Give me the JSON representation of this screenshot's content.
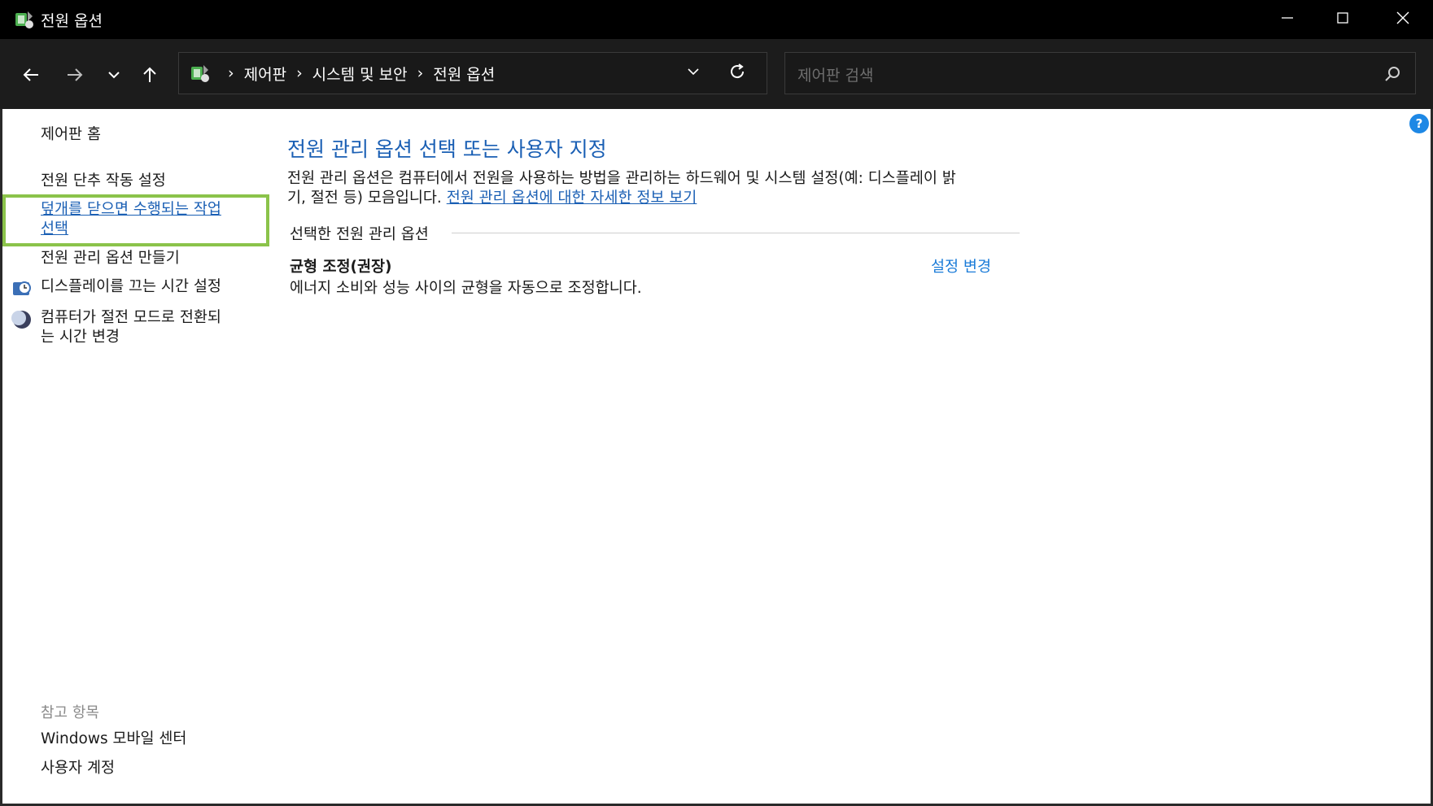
{
  "window": {
    "title": "전원 옵션",
    "app_icon": "power-options-icon",
    "controls": {
      "minimize": "minimize-icon",
      "maximize": "maximize-icon",
      "close": "close-icon"
    }
  },
  "navigation": {
    "breadcrumbs": [
      "제어판",
      "시스템 및 보안",
      "전원 옵션"
    ],
    "search_placeholder": "제어판 검색"
  },
  "sidebar": {
    "home": "제어판 홈",
    "links": [
      {
        "label": "전원 단추 작동 설정"
      },
      {
        "label": "덮개를 닫으면 수행되는 작업 선택",
        "line1": "덮개를 닫으면 수행되는 작업",
        "line2": "선택",
        "active": true
      },
      {
        "label": "전원 관리 옵션 만들기"
      },
      {
        "label": "디스플레이를 끄는 시간 설정",
        "icon": "display-clock-icon"
      },
      {
        "label": "컴퓨터가 절전 모드로 전환되는 시간 변경",
        "line1": "컴퓨터가 절전 모드로 전환되",
        "line2": "는 시간 변경",
        "icon": "sleep-moon-icon"
      }
    ],
    "see_also": {
      "heading": "참고 항목",
      "items": [
        "Windows 모바일 센터",
        "사용자 계정"
      ]
    }
  },
  "main": {
    "title": "전원 관리 옵션 선택 또는 사용자 지정",
    "description_line1": "전원 관리 옵션은 컴퓨터에서 전원을 사용하는 방법을 관리하는 하드웨어 및 시스템 설정(예: 디스플레이 밝",
    "description_line2_prefix": "기, 절전 등) 모음입니다.",
    "description_link": "전원 관리 옵션에 대한 자세한 정보 보기",
    "section_label": "선택한 전원 관리 옵션",
    "plan": {
      "name": "균형 조정(권장)",
      "description": "에너지 소비와 성능 사이의 균형을 자동으로 조정합니다.",
      "change_link": "설정 변경"
    }
  },
  "colors": {
    "titlebar_bg": "#000000",
    "navbar_bg": "#1c1c1c",
    "link_blue": "#1a5fb4",
    "highlight_green": "#8bc34a"
  }
}
